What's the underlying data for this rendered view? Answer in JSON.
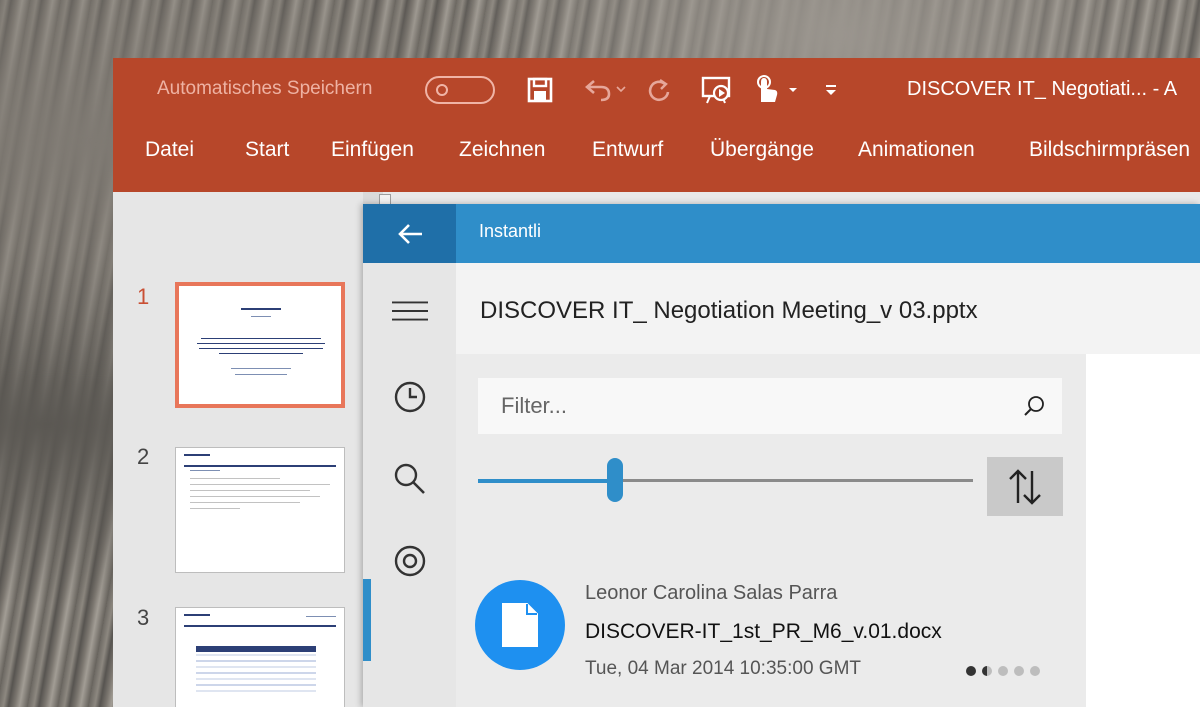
{
  "powerpoint": {
    "autosave_label": "Automatisches Speichern",
    "window_title": "DISCOVER IT_ Negotiati...  -  A",
    "tabs": [
      {
        "label": "Datei"
      },
      {
        "label": "Start"
      },
      {
        "label": "Einfügen"
      },
      {
        "label": "Zeichnen"
      },
      {
        "label": "Entwurf"
      },
      {
        "label": "Übergänge"
      },
      {
        "label": "Animationen"
      },
      {
        "label": "Bildschirmpräsen"
      }
    ],
    "slides": [
      {
        "number": "1",
        "active": true
      },
      {
        "number": "2",
        "active": false
      },
      {
        "number": "3",
        "active": false
      }
    ]
  },
  "instantli": {
    "app_title": "Instantli",
    "doc_title": "DISCOVER IT_ Negotiation Meeting_v 03.pptx",
    "filter_placeholder": "Filter...",
    "slider_value_fraction": 0.26,
    "results": [
      {
        "author": "Leonor Carolina Salas Parra",
        "filename": "DISCOVER-IT_1st_PR_M6_v.01.docx",
        "date": "Tue, 04 Mar 2014 10:35:00 GMT"
      }
    ],
    "icons": [
      "back-arrow-icon",
      "hamburger-menu-icon",
      "clock-icon",
      "search-icon",
      "target-icon",
      "sort-arrows-icon",
      "document-icon"
    ],
    "colors": {
      "accent": "#2f8ec9",
      "header_dark": "#1f6fa8",
      "ppt_red": "#b7472a",
      "doc_blue": "#1e90f0"
    }
  }
}
